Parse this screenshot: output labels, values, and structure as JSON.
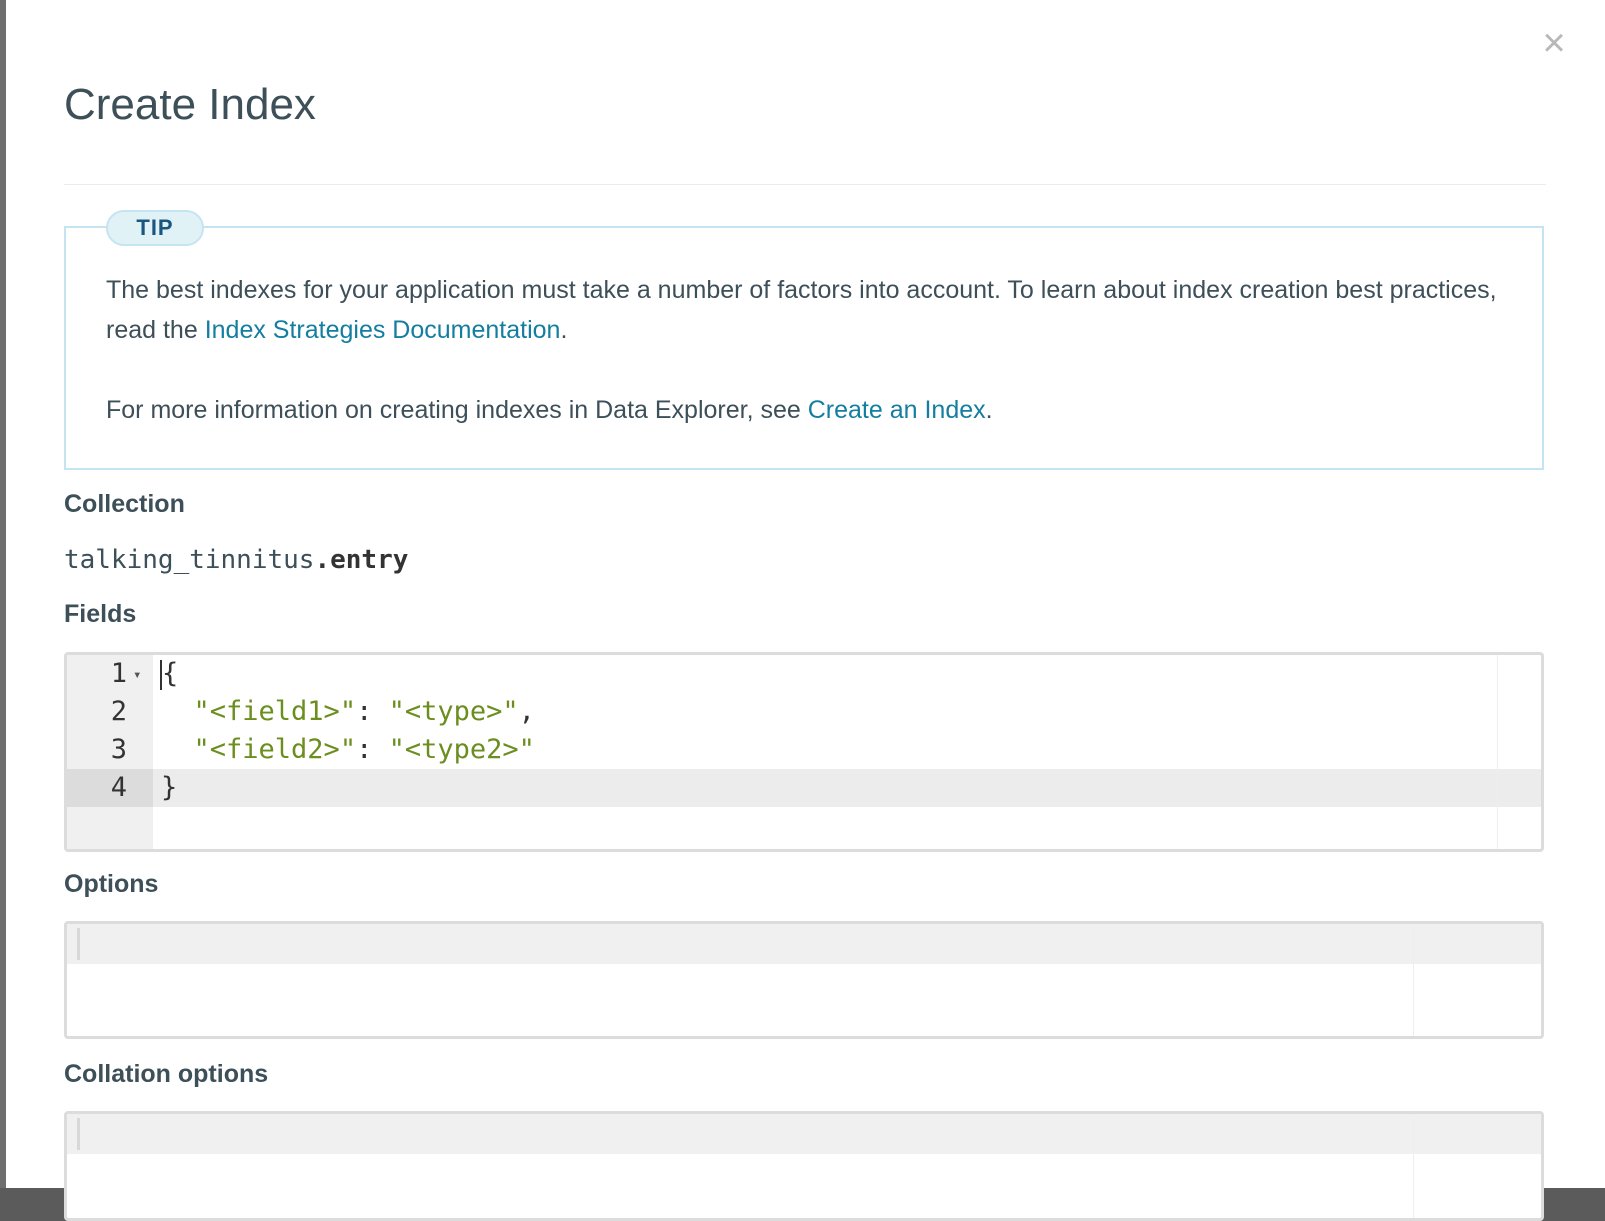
{
  "modal": {
    "title": "Create Index",
    "close_glyph": "×"
  },
  "tip": {
    "badge": "TIP",
    "para1_text": "The best indexes for your application must take a number of factors into account. To learn about index creation best practices, read the ",
    "para1_link": "Index Strategies Documentation",
    "para1_end": ".",
    "para2_text": "For more information on creating indexes in Data Explorer, see ",
    "para2_link": "Create an Index",
    "para2_end": "."
  },
  "collection": {
    "label": "Collection",
    "db": "talking_tinnitus",
    "name": ".entry"
  },
  "fields": {
    "label": "Fields",
    "line_numbers": [
      "1",
      "2",
      "3",
      "4"
    ],
    "lines": [
      {
        "pre": "",
        "key": "",
        "sep": "",
        "val": "",
        "post": "{"
      },
      {
        "pre": "  ",
        "key": "\"<field1>\"",
        "sep": ": ",
        "val": "\"<type>\"",
        "post": ","
      },
      {
        "pre": "  ",
        "key": "\"<field2>\"",
        "sep": ": ",
        "val": "\"<type2>\"",
        "post": ""
      },
      {
        "pre": "",
        "key": "",
        "sep": "",
        "val": "",
        "post": "}"
      }
    ]
  },
  "options": {
    "label": "Options"
  },
  "collation": {
    "label": "Collation options"
  },
  "colors": {
    "text": "#3d4f58",
    "link": "#137ea0",
    "tip_border": "#c5e4f2",
    "string": "#6b8e1f"
  }
}
